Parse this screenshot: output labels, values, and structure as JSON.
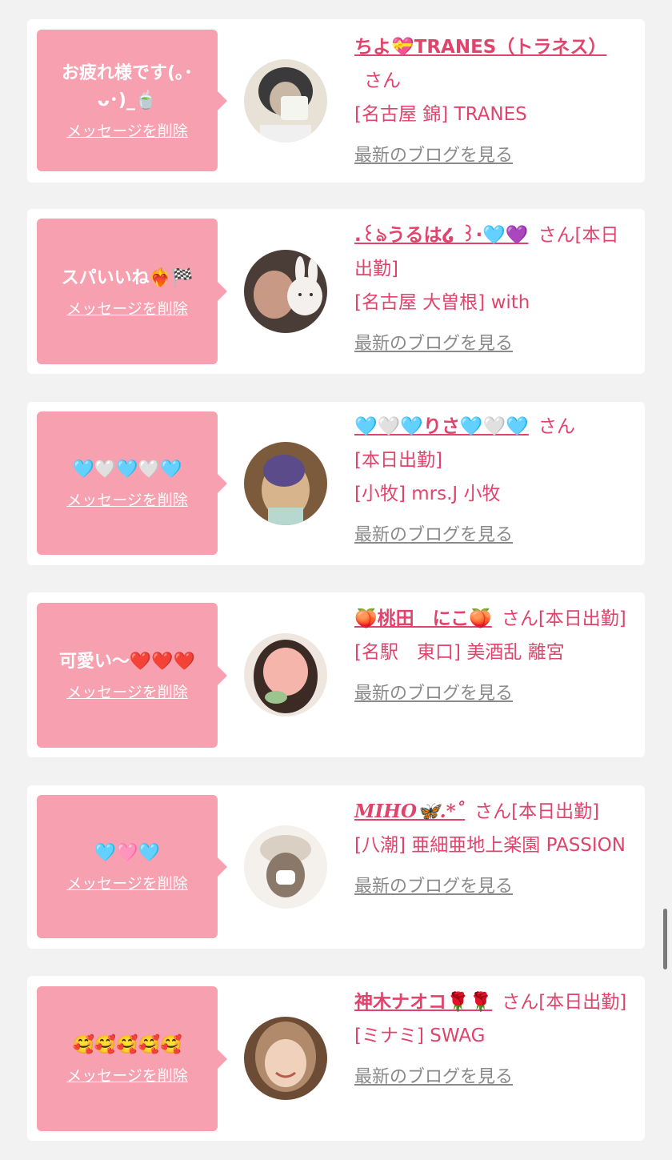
{
  "common": {
    "delete_label": "メッセージを削除",
    "blog_label": "最新のブログを見る",
    "san_label": "さん"
  },
  "cards": [
    {
      "message": "お疲れ様です(｡･ ᴗ･)_🍵",
      "name": "ちよ💝TRANES（トラネス）",
      "status": "",
      "shop": "[名古屋 錦] TRANES",
      "avatar_colors": [
        "#3a3a3a",
        "#c9b8a6",
        "#e8e2d6"
      ]
    },
    {
      "message": "スパいいね❤️‍🔥🏁",
      "name": ".꒰ঌうるは໒ ꒱·🩵💜",
      "status": "[本日出勤]",
      "shop": "[名古屋 大曽根] with",
      "avatar_colors": [
        "#4a3c36",
        "#c89a86",
        "#f3f0ee"
      ]
    },
    {
      "message": "🩵🤍🩵🤍🩵",
      "name": "🩵🤍🩵りさ🩵🤍🩵",
      "status": "[本日出勤]",
      "shop": "[小牧] mrs.J 小牧",
      "avatar_colors": [
        "#5b4b8a",
        "#d8b48c",
        "#7c5a3c"
      ]
    },
    {
      "message": "可愛い〜❤️❤️❤️",
      "name": "🍑桃田　にこ🍑",
      "status": "[本日出勤]",
      "shop": "[名駅　東口] 美酒乱 離宮",
      "avatar_colors": [
        "#3c2a24",
        "#f6b5aa",
        "#efe6df"
      ]
    },
    {
      "message": "🩵🩷🩵",
      "name": "MIHO🦋.*˚",
      "status": "[本日出勤]",
      "shop": "[八潮] 亜細亜地上楽園 PASSION",
      "avatar_colors": [
        "#d9cfc2",
        "#8a7868",
        "#f4f1ec"
      ]
    },
    {
      "message": "🥰🥰🥰🥰🥰",
      "name": "神木ナオコ🌹🌹",
      "status": "[本日出勤]",
      "shop": "[ミナミ] SWAG",
      "avatar_colors": [
        "#b08a6a",
        "#f0d2bc",
        "#6c4c34"
      ]
    }
  ]
}
